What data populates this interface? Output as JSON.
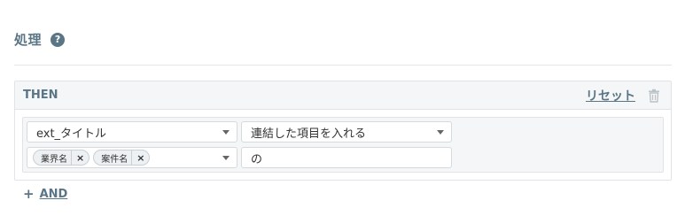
{
  "section": {
    "title": "処理",
    "help_icon": "?"
  },
  "then_panel": {
    "label": "THEN",
    "reset_label": "リセット",
    "actions": [
      {
        "field_value": "ext_タイトル",
        "method_value": "連結した項目を入れる",
        "source_tags": [
          "業界名",
          "案件名"
        ],
        "tag_remove_glyph": "×",
        "joiner_value": "の"
      }
    ]
  },
  "add_and": {
    "plus": "+",
    "label": "AND"
  },
  "colors": {
    "accent": "#5a7585",
    "panel_bg": "#f4f6f7",
    "border": "#e1e4e6"
  }
}
